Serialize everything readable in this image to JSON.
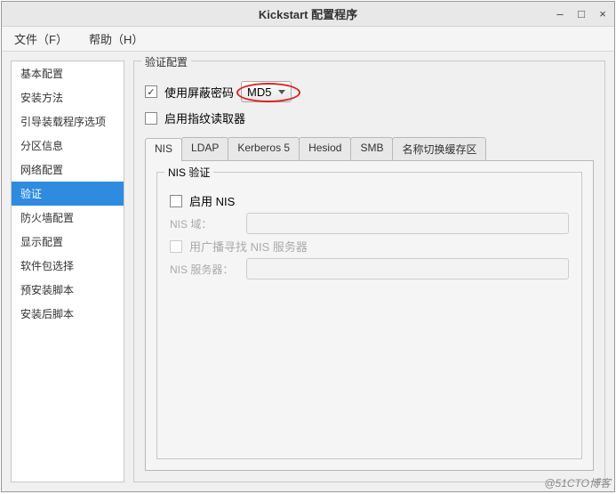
{
  "window": {
    "title": "Kickstart 配置程序"
  },
  "menu": {
    "file": "文件（F）",
    "help": "帮助（H）"
  },
  "sidebar": {
    "items": [
      {
        "label": "基本配置",
        "selected": false
      },
      {
        "label": "安装方法",
        "selected": false
      },
      {
        "label": "引导装载程序选项",
        "selected": false
      },
      {
        "label": "分区信息",
        "selected": false
      },
      {
        "label": "网络配置",
        "selected": false
      },
      {
        "label": "验证",
        "selected": true
      },
      {
        "label": "防火墙配置",
        "selected": false
      },
      {
        "label": "显示配置",
        "selected": false
      },
      {
        "label": "软件包选择",
        "selected": false
      },
      {
        "label": "预安装脚本",
        "selected": false
      },
      {
        "label": "安装后脚本",
        "selected": false
      }
    ]
  },
  "panel": {
    "title": "验证配置",
    "use_shadow_pwd": {
      "label": "使用屏蔽密码",
      "checked": true
    },
    "hash_combo": {
      "value": "MD5"
    },
    "fingerprint": {
      "label": "启用指纹读取器",
      "checked": false
    },
    "tabs": [
      "NIS",
      "LDAP",
      "Kerberos 5",
      "Hesiod",
      "SMB",
      "名称切换缓存区"
    ],
    "active_tab": "NIS",
    "nis": {
      "group_title": "NIS 验证",
      "enable": {
        "label": "启用 NIS",
        "checked": false
      },
      "domain_label": "NIS 域：",
      "broadcast": {
        "label": "用广播寻找 NIS 服务器",
        "checked": false
      },
      "server_label": "NIS 服务器："
    }
  },
  "watermark": "@51CTO博客"
}
